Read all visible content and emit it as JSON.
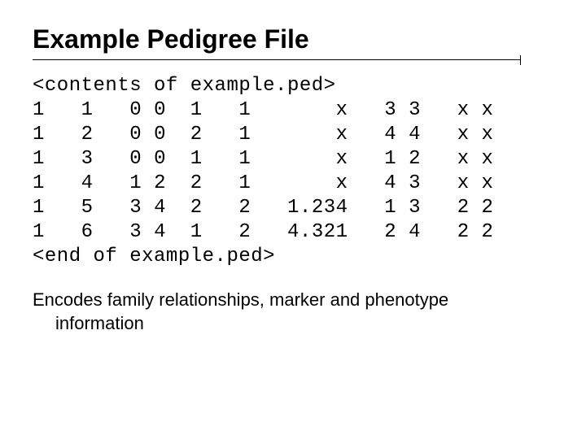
{
  "title": "Example Pedigree File",
  "ped": {
    "open_tag": "<contents of example.ped>",
    "close_tag": "<end of example.ped>",
    "rows": [
      {
        "fam": "1",
        "id": "1",
        "fa": "0",
        "mo": "0",
        "sex": "1",
        "aff": "1",
        "pheno": "    x",
        "m1a": "3",
        "m1b": "3",
        "m2a": "x",
        "m2b": "x"
      },
      {
        "fam": "1",
        "id": "2",
        "fa": "0",
        "mo": "0",
        "sex": "2",
        "aff": "1",
        "pheno": "    x",
        "m1a": "4",
        "m1b": "4",
        "m2a": "x",
        "m2b": "x"
      },
      {
        "fam": "1",
        "id": "3",
        "fa": "0",
        "mo": "0",
        "sex": "1",
        "aff": "1",
        "pheno": "    x",
        "m1a": "1",
        "m1b": "2",
        "m2a": "x",
        "m2b": "x"
      },
      {
        "fam": "1",
        "id": "4",
        "fa": "1",
        "mo": "2",
        "sex": "2",
        "aff": "1",
        "pheno": "    x",
        "m1a": "4",
        "m1b": "3",
        "m2a": "x",
        "m2b": "x"
      },
      {
        "fam": "1",
        "id": "5",
        "fa": "3",
        "mo": "4",
        "sex": "2",
        "aff": "2",
        "pheno": "1.234",
        "m1a": "1",
        "m1b": "3",
        "m2a": "2",
        "m2b": "2"
      },
      {
        "fam": "1",
        "id": "6",
        "fa": "3",
        "mo": "4",
        "sex": "1",
        "aff": "2",
        "pheno": "4.321",
        "m1a": "2",
        "m1b": "4",
        "m2a": "2",
        "m2b": "2"
      }
    ]
  },
  "caption_line1": "Encodes family relationships, marker and phenotype",
  "caption_line2": "information"
}
